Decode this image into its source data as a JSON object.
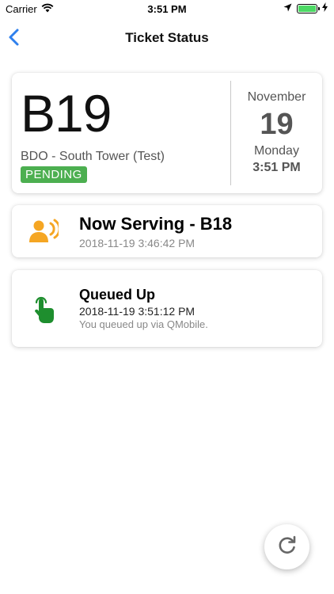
{
  "status_bar": {
    "carrier": "Carrier",
    "time": "3:51 PM",
    "icons": [
      "wifi-icon",
      "location-arrow-icon",
      "battery-icon",
      "charging-bolt-icon"
    ]
  },
  "nav": {
    "title": "Ticket Status",
    "back_icon": "chevron-left-icon"
  },
  "ticket": {
    "number": "B19",
    "branch": "BDO - South Tower (Test)",
    "status": "PENDING",
    "month": "November",
    "day": "19",
    "weekday": "Monday",
    "time": "3:51 PM"
  },
  "serving": {
    "icon": "speaking-person-icon",
    "title": "Now Serving - B18",
    "timestamp": "2018-11-19 3:46:42 PM"
  },
  "queued": {
    "icon": "tap-finger-icon",
    "title": "Queued Up",
    "timestamp": "2018-11-19 3:51:12 PM",
    "note": "You queued up via QMobile."
  },
  "refresh": {
    "icon": "refresh-icon"
  },
  "colors": {
    "accent": "#2f80ed",
    "pending_badge": "#4caf50",
    "serving_icon": "#f5a623",
    "queued_icon": "#1e8e2e",
    "battery_fill": "#4cd964"
  }
}
